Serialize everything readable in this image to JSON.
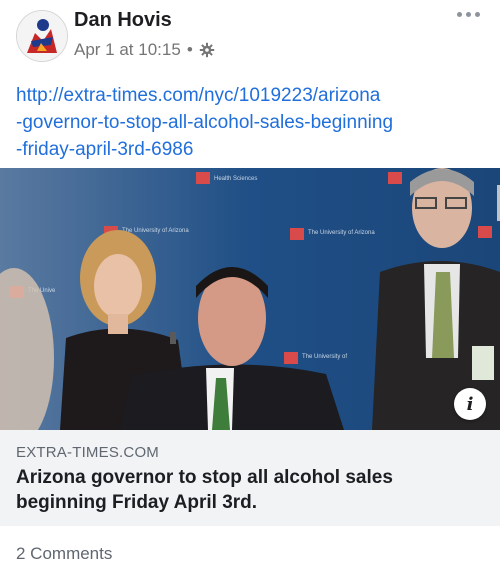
{
  "post": {
    "author": "Dan Hovis",
    "timestamp": "Apr 1 at 10:15",
    "separator": "•",
    "privacy_icon": "gear-icon",
    "more_icon": "more-dots-icon",
    "link_lines": [
      "http://extra-times.com/nyc/1019223/arizona",
      "-governor-to-stop-all-alcohol-sales-beginning",
      "-friday-april-3rd-6986"
    ]
  },
  "preview": {
    "backdrop_text": "The University of Arizona Health Sciences",
    "info_label": "i",
    "info_icon": "info-icon"
  },
  "link_card": {
    "domain": "EXTRA-TIMES.COM",
    "headline": "Arizona governor to stop all alcohol sales beginning Friday April 3rd."
  },
  "footer": {
    "comments": "2 Comments"
  },
  "colors": {
    "link": "#216fdb",
    "backdrop": "#1f4f86",
    "card_bg": "#f2f3f5"
  }
}
